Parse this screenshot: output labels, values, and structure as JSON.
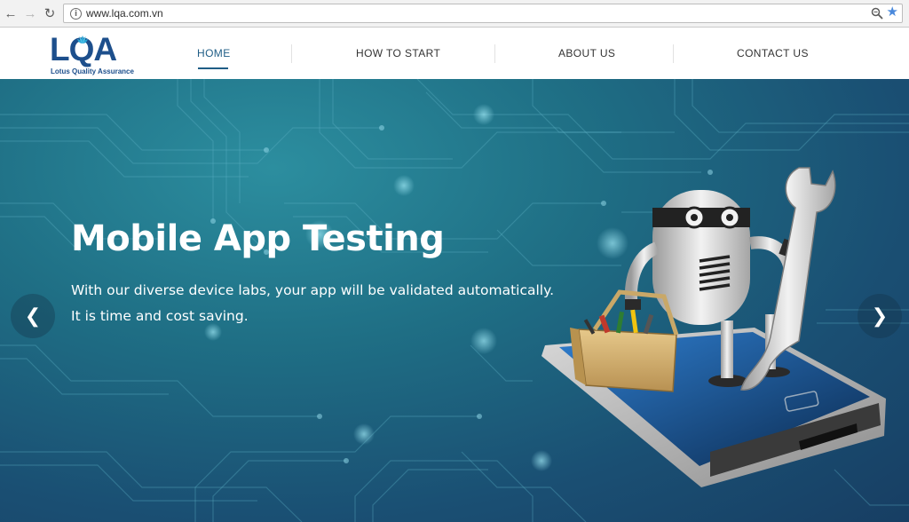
{
  "browser": {
    "url": "www.lqa.com.vn",
    "back_icon": "arrow-left-icon",
    "forward_icon": "arrow-right-icon",
    "reload_icon": "reload-icon",
    "info_icon": "info-icon",
    "zoom_icon": "magnifier-icon",
    "bookmark_icon": "star-icon"
  },
  "header": {
    "logo_text": "LQA",
    "logo_tagline": "Lotus Quality Assurance",
    "nav": [
      {
        "label": "HOME",
        "active": true
      },
      {
        "label": "HOW TO START",
        "active": false
      },
      {
        "label": "ABOUT US",
        "active": false
      },
      {
        "label": "CONTACT US",
        "active": false
      }
    ]
  },
  "hero": {
    "title": "Mobile App Testing",
    "line1": "With our diverse device labs, your app will be validated automatically.",
    "line2": "It is time and cost saving.",
    "prev_icon": "chevron-left-icon",
    "next_icon": "chevron-right-icon",
    "illustration": "robot-with-wrench-on-smartphone"
  },
  "colors": {
    "brand": "#1d4f8c",
    "nav_active": "#1f5d86",
    "hero_background": "#1f6f85",
    "bookmark_star": "#4a89dc"
  }
}
